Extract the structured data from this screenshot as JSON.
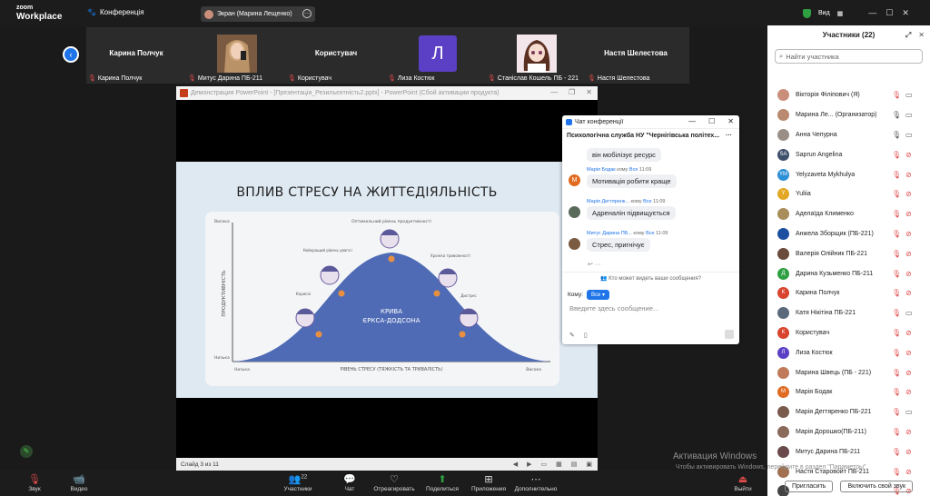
{
  "topbar": {
    "logo_line1": "zoom",
    "logo_line2": "Workplace",
    "conference_label": "Конференція",
    "share_label": "Экран (Марина Лещенко)",
    "view_label": "Вид"
  },
  "strip": {
    "tiles": [
      {
        "big_name": "Карина Полчук",
        "label": "Карина Полчук"
      },
      {
        "big_name": "",
        "label": "Митус Дарина ПБ-211"
      },
      {
        "big_name": "Користувач",
        "label": "Користувач"
      },
      {
        "big_name": "",
        "label": "Лиза Костюк",
        "letter": "Л"
      },
      {
        "big_name": "",
        "label": "Станіслав Кошель ПБ - 221"
      },
      {
        "big_name": "Настя Шелестова",
        "label": "Настя Шелестова"
      }
    ]
  },
  "ppt": {
    "window_title": "Демонстрация PowerPoint - [Презентація_Резильєнтність2.pptx] - PowerPoint (Сбой активации продукта)",
    "slide_title": "ВПЛИВ СТРЕСУ НА ЖИТТЄДІЯЛЬНІСТЬ",
    "status": "Слайд 3 из 11",
    "chart": {
      "y_axis_label": "ПРОДУКТИВНІСТЬ",
      "y_high": "Висока",
      "y_low": "Низька",
      "x_axis_label": "РІВЕНЬ СТРЕСУ (ТЯЖКІСТЬ ТА ТРИВАЛІСТЬ)",
      "x_low": "Низька",
      "x_high": "Висока",
      "curve_label_1": "КРИВА",
      "curve_label_2": "ЄРКСА-ДОДСОНА",
      "peak_label": "Оптимальний рівень продуктивності",
      "left_label": "Найкращий рівень уваги і",
      "left2_label": "Корисні",
      "right_label": "Хроніка тривожності",
      "right2_label": "Дистрес"
    }
  },
  "chat": {
    "title": "Чат конференції",
    "group": "Психологічна служба НУ \"Чернігівська політех...",
    "first_bubble": "він мобілізує ресурс",
    "messages": [
      {
        "author": "Марія Бодак",
        "to": "кому",
        "to_target": "Все",
        "time": "11:09",
        "text": "Мотивація робити краще",
        "initial": "М"
      },
      {
        "author": "Марія Дегтяренк...",
        "to": "кому",
        "to_target": "Все",
        "time": "11:09",
        "text": "Адреналін підвищується",
        "initial": ""
      },
      {
        "author": "Митус Дарина ПБ...",
        "to": "кому",
        "to_target": "Все",
        "time": "11:09",
        "text": "Стрес, пригнічує",
        "initial": ""
      }
    ],
    "who_sees": "Кто может видеть ваши сообщения?",
    "to_label": "Кому:",
    "to_value": "Все",
    "placeholder": "Введите здесь сообщение..."
  },
  "panel": {
    "title": "Участники (22)",
    "search_placeholder": "Найти участника",
    "participants": [
      {
        "name": "Вікторія Філіпович (Я)",
        "initials": "",
        "color": "#c98f7a",
        "mic": "off",
        "video": "on"
      },
      {
        "name": "Марина Ле... (Организатор)",
        "initials": "",
        "color": "#b98a70",
        "mic": "on",
        "video": "on"
      },
      {
        "name": "Анна Чепурна",
        "initials": "",
        "color": "#9a8f86",
        "mic": "on",
        "video": "on"
      },
      {
        "name": "Saprun Angelina",
        "initials": "SA",
        "color": "#3d4f6b",
        "mic": "off",
        "video": "off"
      },
      {
        "name": "Yelyzaveta Mykhulya",
        "initials": "YM",
        "color": "#2d8fd6",
        "mic": "off",
        "video": "off"
      },
      {
        "name": "Yuliia",
        "initials": "Y",
        "color": "#e3a724",
        "mic": "off",
        "video": "off"
      },
      {
        "name": "Аделаїда Клименко",
        "initials": "",
        "color": "#a98d5a",
        "mic": "off",
        "video": "off"
      },
      {
        "name": "Анжела Зборщик (ПБ-221)",
        "initials": "",
        "color": "#1c4fa0",
        "mic": "off",
        "video": "off"
      },
      {
        "name": "Валерія Олійник ПБ-221",
        "initials": "",
        "color": "#6a4a3a",
        "mic": "off",
        "video": "off"
      },
      {
        "name": "Дарина Кузьменко ПБ-211",
        "initials": "Д",
        "color": "#2ea043",
        "mic": "off",
        "video": "off"
      },
      {
        "name": "Карина Полчук",
        "initials": "К",
        "color": "#d9442e",
        "mic": "off",
        "video": "off"
      },
      {
        "name": "Катя Нікітіна ПБ-221",
        "initials": "",
        "color": "#5a6a7a",
        "mic": "off",
        "video": "on"
      },
      {
        "name": "Користувач",
        "initials": "К",
        "color": "#d9442e",
        "mic": "off",
        "video": "off"
      },
      {
        "name": "Лиза Костюк",
        "initials": "Л",
        "color": "#5b3fc4",
        "mic": "off",
        "video": "off"
      },
      {
        "name": "Марина Швець (ПБ - 221)",
        "initials": "",
        "color": "#c07a5a",
        "mic": "off",
        "video": "off"
      },
      {
        "name": "Марія Бодак",
        "initials": "М",
        "color": "#e06a20",
        "mic": "off",
        "video": "off"
      },
      {
        "name": "Марія Дегтяренко ПБ-221",
        "initials": "",
        "color": "#7a5a4a",
        "mic": "off",
        "video": "on"
      },
      {
        "name": "Марія Дорошко(ПБ-211)",
        "initials": "",
        "color": "#8a6a5a",
        "mic": "off",
        "video": "off"
      },
      {
        "name": "Митус Дарина ПБ-211",
        "initials": "",
        "color": "#6a4a4a",
        "mic": "off",
        "video": "off"
      },
      {
        "name": "Настя Старовойт ПБ-211",
        "initials": "",
        "color": "#a07050",
        "mic": "off",
        "video": "off"
      },
      {
        "name": "...",
        "initials": "",
        "color": "#444",
        "mic": "off",
        "video": "off"
      }
    ],
    "invite_label": "Пригласить",
    "unmute_all_label": "Включить свой звук"
  },
  "toolbar": {
    "items": [
      {
        "label": "Звук",
        "icon": "mic-off-icon"
      },
      {
        "label": "Видео",
        "icon": "camera-icon"
      },
      {
        "label": "Участники",
        "icon": "participants-icon",
        "count": "22"
      },
      {
        "label": "Чат",
        "icon": "chat-icon"
      },
      {
        "label": "Отреагировать",
        "icon": "heart-icon"
      },
      {
        "label": "Поделиться",
        "icon": "share-icon"
      },
      {
        "label": "Приложения",
        "icon": "apps-icon"
      },
      {
        "label": "Дополнительно",
        "icon": "more-icon"
      },
      {
        "label": "Выйти",
        "icon": "leave-icon"
      }
    ]
  },
  "windows_activation": {
    "line1": "Активация Windows",
    "line2": "Чтобы активировать Windows, перейдите в раздел \"Параметры\"."
  }
}
